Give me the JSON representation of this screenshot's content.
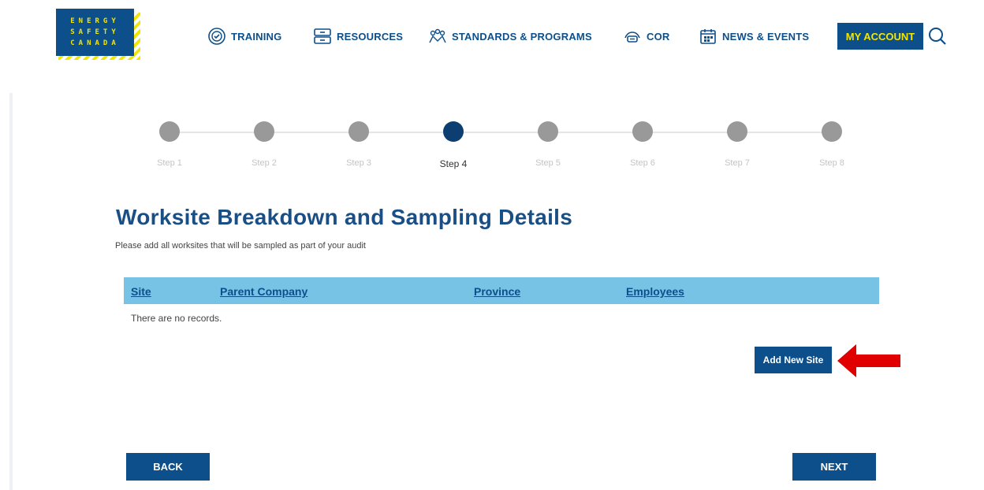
{
  "header": {
    "logo": {
      "line1": "ENERGY",
      "line2": "SAFETY",
      "line3": "CANADA"
    },
    "nav": [
      {
        "label": "TRAINING",
        "icon": "training-icon"
      },
      {
        "label": "RESOURCES",
        "icon": "resources-icon"
      },
      {
        "label": "STANDARDS & PROGRAMS",
        "icon": "standards-icon"
      },
      {
        "label": "COR",
        "icon": "cor-icon"
      },
      {
        "label": "NEWS & EVENTS",
        "icon": "calendar-icon"
      }
    ],
    "my_account": "MY ACCOUNT",
    "search_icon": "search-icon"
  },
  "steps": {
    "items": [
      "Step 1",
      "Step 2",
      "Step 3",
      "Step 4",
      "Step 5",
      "Step 6",
      "Step 7",
      "Step 8"
    ],
    "active": 4
  },
  "main": {
    "title": "Worksite Breakdown and Sampling Details",
    "subtitle": "Please add all worksites that will be sampled as part of your audit",
    "table": {
      "columns": [
        "Site",
        "Parent Company",
        "Province",
        "Employees"
      ],
      "empty_text": "There are no records."
    },
    "add_button": "Add New Site",
    "back_button": "BACK",
    "next_button": "NEXT"
  },
  "colors": {
    "brand_blue": "#0d4f8b",
    "brand_yellow": "#f3e600",
    "table_header": "#76c3e6",
    "arrow": "#e00000"
  }
}
